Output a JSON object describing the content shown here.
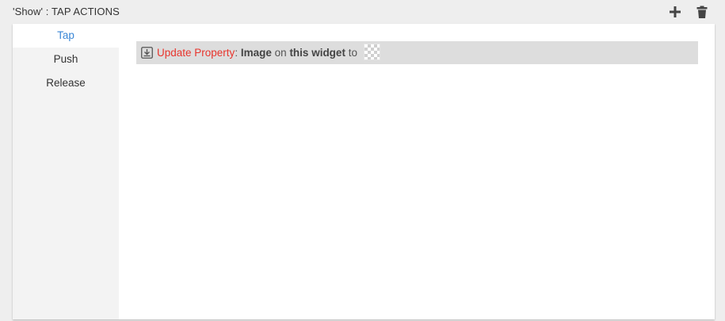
{
  "header": {
    "title": "'Show' : TAP ACTIONS",
    "add_icon": "plus-icon",
    "delete_icon": "trash-icon"
  },
  "sidebar": {
    "items": [
      {
        "label": "Tap",
        "active": true
      },
      {
        "label": "Push",
        "active": false
      },
      {
        "label": "Release",
        "active": false
      }
    ]
  },
  "action": {
    "icon": "update-property-icon",
    "name": "Update Property",
    "separator": ":",
    "property": "Image",
    "on_text": "on",
    "target": "this widget",
    "to_text": "to",
    "value_icon": "transparent-image-icon"
  },
  "colors": {
    "accent": "#3a87d6",
    "action_name": "#e8352d",
    "row_bg": "#dddddd",
    "sidebar_bg": "#f3f3f3"
  }
}
